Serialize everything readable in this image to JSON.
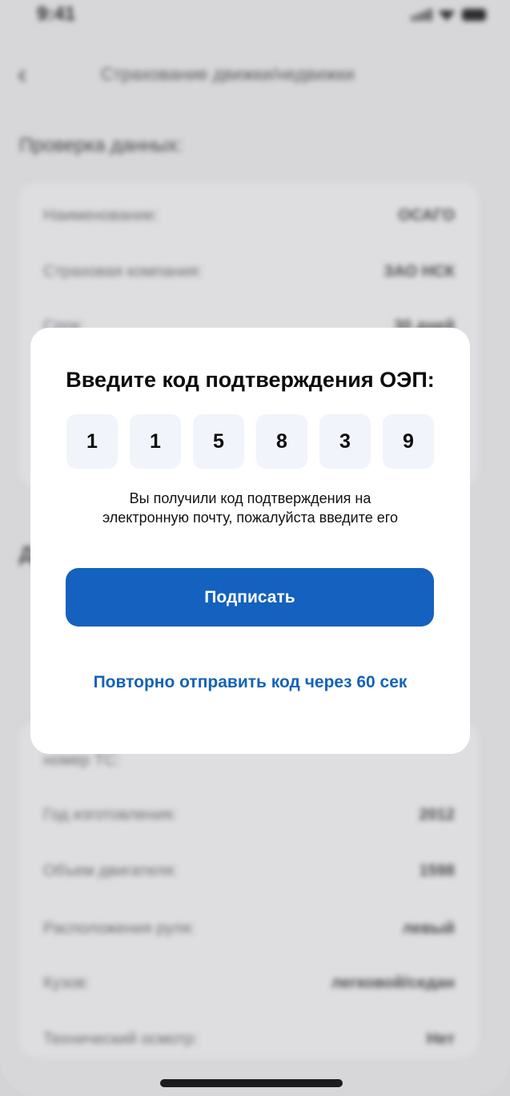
{
  "status_bar": {
    "time": "9:41"
  },
  "screen": {
    "title": "Страхование движки/недвижки",
    "section_title": "Проверка данных:",
    "section2_title": "Д",
    "top_rows": [
      {
        "label": "Наименование:",
        "value": "ОСАГО"
      },
      {
        "label": "Страховая компания:",
        "value": "ЗАО НСК"
      },
      {
        "label": "Срок:",
        "value": "30 дней"
      }
    ],
    "bottom_rows": [
      {
        "label": "номер ТС:",
        "value": ""
      },
      {
        "label": "Год изготовления:",
        "value": "2012"
      },
      {
        "label": "Объем двигателя:",
        "value": "1598"
      },
      {
        "label": "Расположения руля:",
        "value": "левый"
      },
      {
        "label": "Кузов:",
        "value": "легковой/седан"
      },
      {
        "label": "Технический осмотр:",
        "value": "Нет"
      }
    ]
  },
  "modal": {
    "title": "Введите код подтверждения ОЭП:",
    "code_digits": [
      "1",
      "1",
      "5",
      "8",
      "3",
      "9"
    ],
    "hint_line1": "Вы получили код подтверждения на",
    "hint_line2": "электронную почту, пожалуйста введите его",
    "sign_button": "Подписать",
    "resend_link": "Повторно отправить код через 60 сек"
  },
  "colors": {
    "primary": "#1461c0",
    "link": "#1563b6",
    "code_cell_bg": "#f1f4fa"
  }
}
